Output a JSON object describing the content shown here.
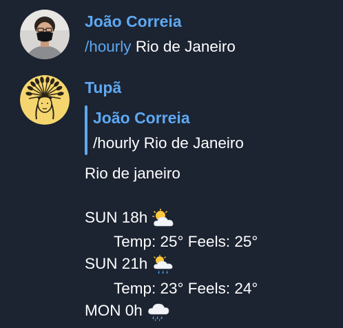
{
  "messages": [
    {
      "sender": "João Correia",
      "avatar": "person-with-mask-avatar",
      "command": "/hourly",
      "argument": "Rio de Janeiro"
    },
    {
      "sender": "Tupã",
      "avatar": "indian-headdress-avatar",
      "reply_to": {
        "author": "João Correia",
        "text": "/hourly Rio de Janeiro"
      },
      "city": "Rio de janeiro",
      "forecast": [
        {
          "time": "SUN 18h",
          "icon": "sun-behind-cloud-icon",
          "details": "Temp: 25° Feels: 25°"
        },
        {
          "time": "SUN 21h",
          "icon": "sun-behind-rain-cloud-icon",
          "details": "Temp: 23° Feels: 24°"
        },
        {
          "time": "MON 0h",
          "icon": "cloud-with-rain-icon"
        }
      ]
    }
  ],
  "colors": {
    "background": "#1c2331",
    "accent": "#5ea9f2",
    "text": "#ffffff",
    "tupa_avatar_bg": "#f5d66e"
  }
}
